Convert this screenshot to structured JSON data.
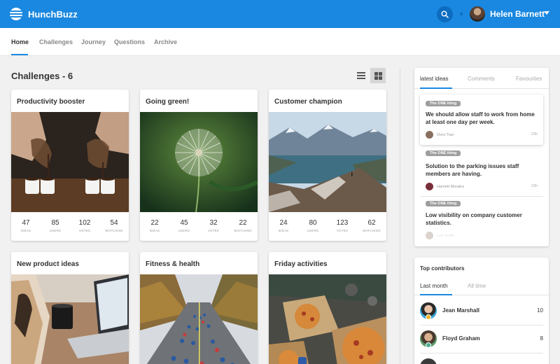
{
  "header": {
    "app_name": "HunchBuzz",
    "user_name": "Helen Barnett",
    "brand_color": "#1a88e0"
  },
  "nav": {
    "tabs": [
      {
        "label": "Home",
        "active": true
      },
      {
        "label": "Challenges",
        "active": false
      },
      {
        "label": "Journey",
        "active": false
      },
      {
        "label": "Questions",
        "active": false
      },
      {
        "label": "Archive",
        "active": false
      }
    ]
  },
  "main": {
    "title": "Challenges - 6",
    "stat_labels": [
      "IDEAS",
      "USERS",
      "VOTES",
      "WATCHING"
    ],
    "cards": [
      {
        "title": "Productivity booster",
        "image": "coffee-pour-photo",
        "stats": [
          "47",
          "85",
          "102",
          "54"
        ]
      },
      {
        "title": "Going green!",
        "image": "dandelion-photo",
        "stats": [
          "22",
          "45",
          "32",
          "22"
        ]
      },
      {
        "title": "Customer champion",
        "image": "mountain-lake-photo",
        "stats": [
          "24",
          "80",
          "123",
          "62"
        ]
      },
      {
        "title": "New product ideas",
        "image": "laptop-desk-photo",
        "stats": []
      },
      {
        "title": "Fitness & health",
        "image": "marathon-runners-photo",
        "stats": []
      },
      {
        "title": "Friday activities",
        "image": "pizza-boxes-photo",
        "stats": []
      }
    ]
  },
  "ideas_panel": {
    "tabs": [
      "latest ideas",
      "Comments",
      "Favourites"
    ],
    "ideas": [
      {
        "tag": "The ONE thing",
        "text": "We should allow staff to work from home at least one day per week.",
        "author": "Dora Tran",
        "time": "23h"
      },
      {
        "tag": "The ONE thing",
        "text": "Solution to the parking issues staff members are having.",
        "author": "Harriett Morales",
        "time": "23h"
      },
      {
        "tag": "The ONE thing",
        "text": "Low visibility on company customer statistics.",
        "author": "Lee Smith",
        "time": ""
      }
    ]
  },
  "contributors_panel": {
    "title": "Top contributors",
    "tabs": [
      "Last month",
      "All time"
    ],
    "rows": [
      {
        "name": "Jean Marshall",
        "count": "10",
        "badge_color": "#f2b630"
      },
      {
        "name": "Floyd Graham",
        "count": "8",
        "badge_color": "#4caf8f"
      }
    ]
  }
}
